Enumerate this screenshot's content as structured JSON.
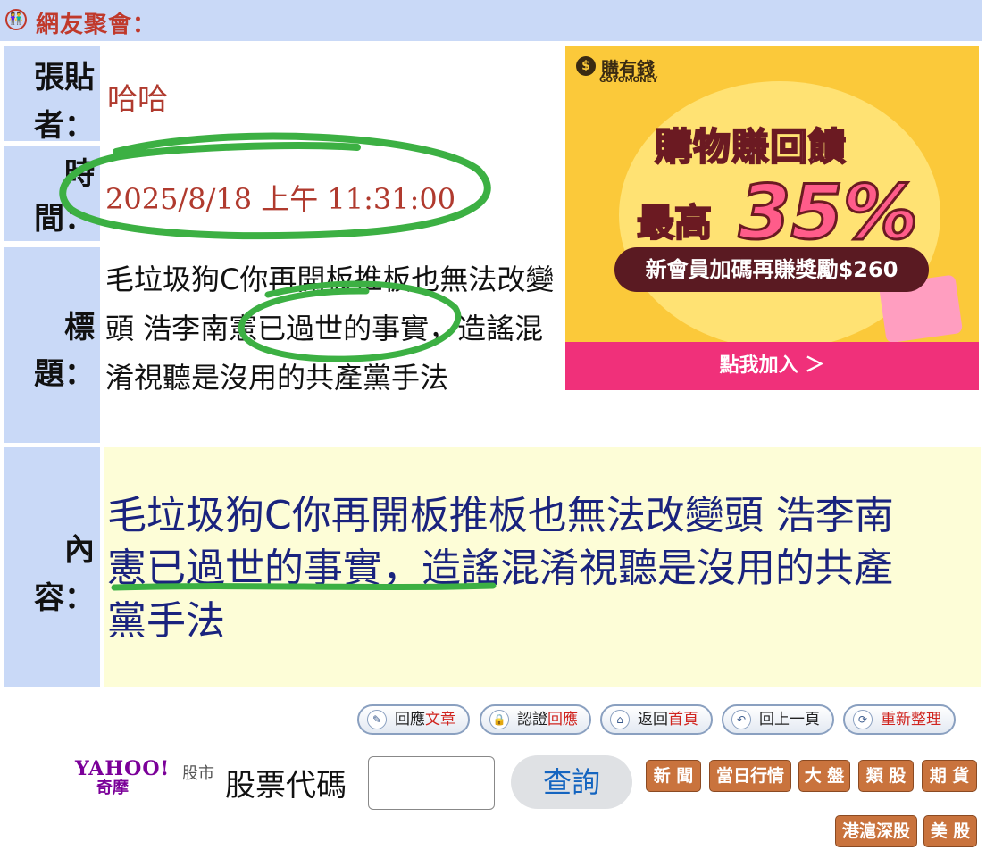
{
  "header": {
    "icon": "people-icon",
    "title": "網友聚會："
  },
  "fields": {
    "author_label": [
      "張貼",
      "者："
    ],
    "author": "哈哈",
    "time_label": [
      "時",
      "間："
    ],
    "time": "2025/8/18 上午 11:31:00",
    "title_label": [
      "標",
      "題："
    ],
    "title": "毛垃圾狗C你再開板推板也無法改變頭 浩李南憲已過世的事實，造謠混淆視聽是沒用的共產黨手法",
    "content_label": [
      "內",
      "容："
    ],
    "content": "毛垃圾狗C你再開板推板也無法改變頭 浩李南憲已過世的事實，造謠混淆視聽是沒用的共產黨手法"
  },
  "ad": {
    "brand": "購有錢",
    "brand_en": "GOYOMONEY",
    "headline": "購物賺回饋",
    "max_label": "最高",
    "percent": "35%",
    "bonus": "新會員加碼再賺獎勵$260",
    "cta": "點我加入 ＞",
    "colors": {
      "background": "#fbc93a",
      "cta": "#f0307a",
      "pill": "#5a1a22"
    }
  },
  "actions": [
    {
      "icon": "reply-icon",
      "prefix": "回應",
      "suffix": "文章"
    },
    {
      "icon": "lock-icon",
      "prefix": "認證",
      "suffix": "回應"
    },
    {
      "icon": "home-icon",
      "prefix": "返回",
      "suffix": "首頁"
    },
    {
      "icon": "back-arrow-icon",
      "prefix": "回上一頁",
      "suffix": ""
    },
    {
      "icon": "refresh-icon",
      "prefix": "",
      "suffix": "重新整理"
    }
  ],
  "stock": {
    "logo": "YAHOO!",
    "logo_sub": "奇摩",
    "market_sub": "股市",
    "label": "股票代碼",
    "input_value": "",
    "query": "查詢",
    "buttons": [
      "新 聞",
      "當日行情",
      "大 盤",
      "類 股",
      "期 貨",
      "港滬深股",
      "美 股"
    ]
  },
  "colors": {
    "label_bg": "#c9d9f7",
    "content_bg": "#fdfdd7",
    "value_red": "#b03a2e",
    "content_blue": "#1a237e",
    "annotation_green": "#3cb043"
  }
}
